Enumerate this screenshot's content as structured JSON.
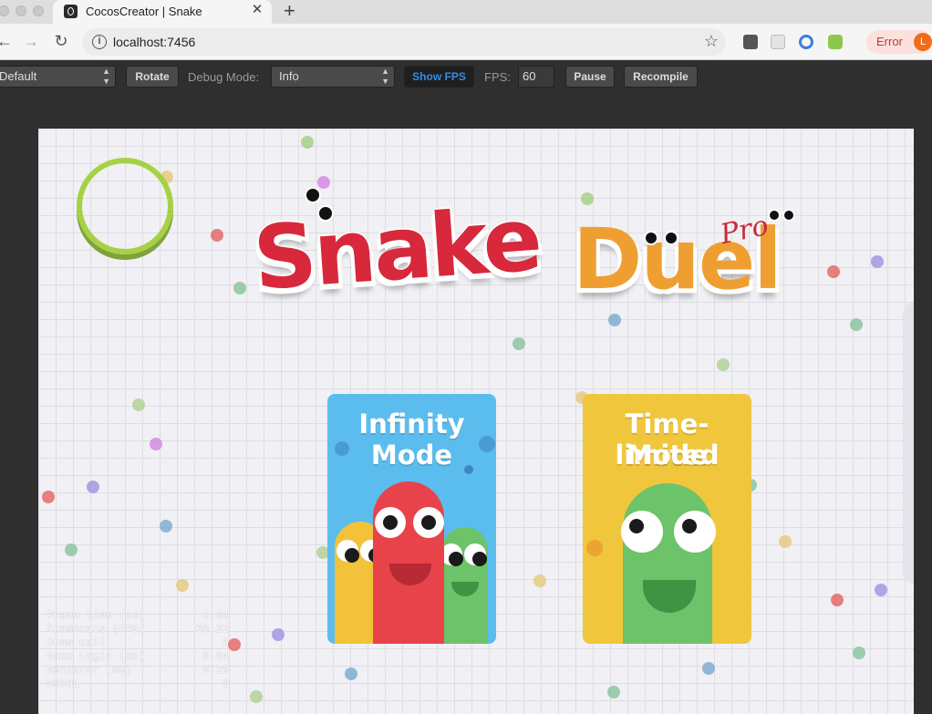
{
  "browser": {
    "tab_title": "CocosCreator | Snake",
    "tab_close": "✕",
    "new_tab": "+",
    "url": "localhost:7456",
    "error_label": "Error",
    "avatar_letter": "L"
  },
  "cocos_toolbar": {
    "device_select": "Default",
    "rotate_label": "Rotate",
    "debug_mode_label": "Debug Mode:",
    "debug_mode_value": "Info",
    "show_fps_label": "Show FPS",
    "fps_label": "FPS:",
    "fps_value": "60",
    "pause_label": "Pause",
    "recompile_label": "Recompile"
  },
  "game": {
    "logo_snake": "Snake",
    "logo_duel": "Duel",
    "logo_pro": "Pro",
    "modes": [
      {
        "title_line1": "Infinity",
        "title_line2": "Mode",
        "color": "#5bbdee"
      },
      {
        "title_line1": "Time-limited",
        "title_line2": "Mode",
        "color": "#f0c63d"
      }
    ],
    "stats": [
      {
        "label": "Frame time (ms)",
        "value": "0.34"
      },
      {
        "label": "Framerate (FPS)",
        "value": "60.22"
      },
      {
        "label": "Draw call",
        "value": "5"
      },
      {
        "label": "Game Logic (ms)",
        "value": "0.04"
      },
      {
        "label": "Renderer (ms)",
        "value": "0.29"
      },
      {
        "label": "WebGL",
        "value": "0"
      }
    ]
  },
  "colors": {
    "snake_red": "#d7283c",
    "duel_orange": "#ef9f32",
    "ring_green": "#a7d144",
    "fps_active_blue": "#2d8fea"
  }
}
